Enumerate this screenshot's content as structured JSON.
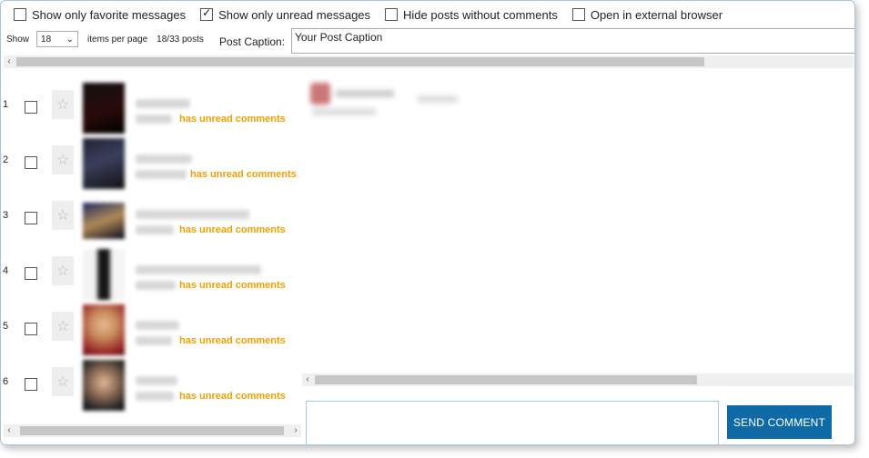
{
  "filters": [
    {
      "label": "Show only favorite messages",
      "checked": false
    },
    {
      "label": "Show only unread messages",
      "checked": true
    },
    {
      "label": "Hide posts without comments",
      "checked": false
    },
    {
      "label": "Open in external browser",
      "checked": false
    }
  ],
  "pager": {
    "show_label": "Show",
    "per_page_value": "18",
    "per_page_label": "items per page",
    "count": "18/33 posts"
  },
  "caption": {
    "label": "Post Caption:",
    "value": "Your Post Caption"
  },
  "posts": [
    {
      "num": "1",
      "status": "has unread comments"
    },
    {
      "num": "2",
      "status": "has unread comments"
    },
    {
      "num": "3",
      "status": "has unread comments"
    },
    {
      "num": "4",
      "status": "has unread comments"
    },
    {
      "num": "5",
      "status": "has unread comments"
    },
    {
      "num": "6",
      "status": "has unread comments"
    }
  ],
  "send_button": "SEND COMMENT",
  "colors": {
    "unread": "#f0a000",
    "send_button": "#106aa6"
  }
}
